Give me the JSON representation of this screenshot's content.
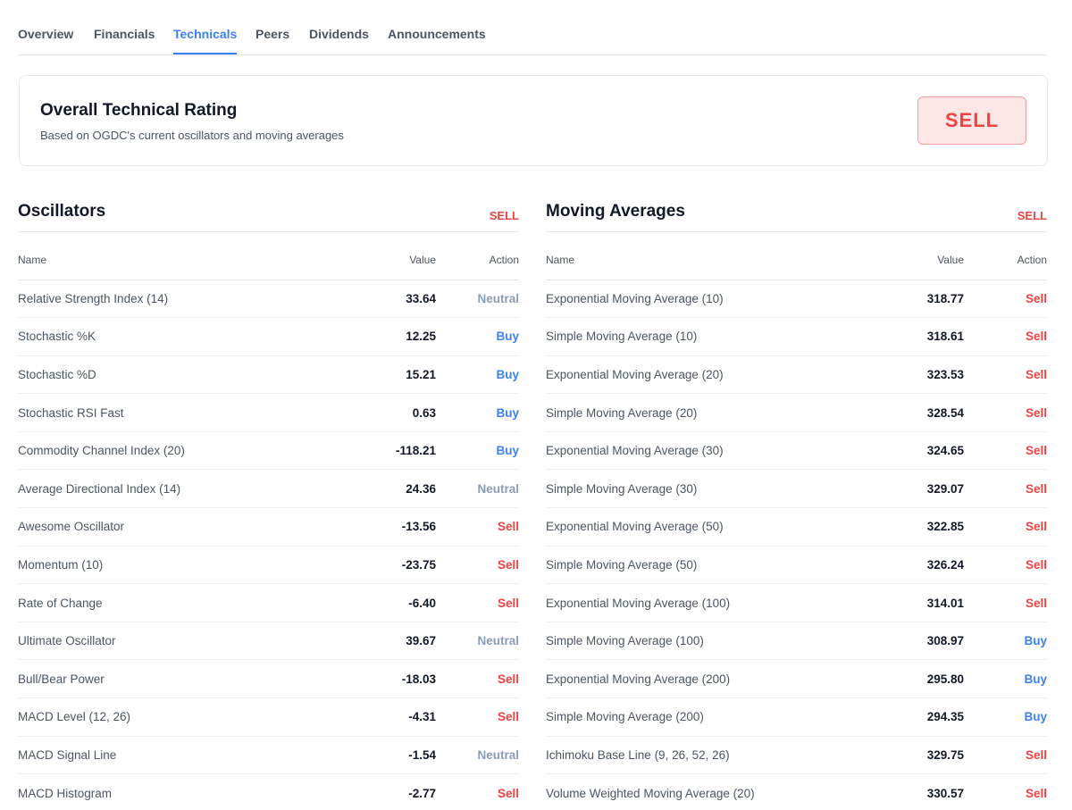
{
  "tabs": [
    "Overview",
    "Financials",
    "Technicals",
    "Peers",
    "Dividends",
    "Announcements"
  ],
  "active_tab": "Technicals",
  "rating": {
    "title": "Overall Technical Rating",
    "subtitle": "Based on OGDC's current oscillators and moving averages",
    "verdict": "SELL"
  },
  "oscillators": {
    "title": "Oscillators",
    "summary": "SELL",
    "headers": {
      "name": "Name",
      "value": "Value",
      "action": "Action"
    },
    "rows": [
      {
        "name": "Relative Strength Index (14)",
        "value": "33.64",
        "action": "Neutral"
      },
      {
        "name": "Stochastic %K",
        "value": "12.25",
        "action": "Buy"
      },
      {
        "name": "Stochastic %D",
        "value": "15.21",
        "action": "Buy"
      },
      {
        "name": "Stochastic RSI Fast",
        "value": "0.63",
        "action": "Buy"
      },
      {
        "name": "Commodity Channel Index (20)",
        "value": "-118.21",
        "action": "Buy"
      },
      {
        "name": "Average Directional Index (14)",
        "value": "24.36",
        "action": "Neutral"
      },
      {
        "name": "Awesome Oscillator",
        "value": "-13.56",
        "action": "Sell"
      },
      {
        "name": "Momentum (10)",
        "value": "-23.75",
        "action": "Sell"
      },
      {
        "name": "Rate of Change",
        "value": "-6.40",
        "action": "Sell"
      },
      {
        "name": "Ultimate Oscillator",
        "value": "39.67",
        "action": "Neutral"
      },
      {
        "name": "Bull/Bear Power",
        "value": "-18.03",
        "action": "Sell"
      },
      {
        "name": "MACD Level (12, 26)",
        "value": "-4.31",
        "action": "Sell"
      },
      {
        "name": "MACD Signal Line",
        "value": "-1.54",
        "action": "Neutral"
      },
      {
        "name": "MACD Histogram",
        "value": "-2.77",
        "action": "Sell"
      }
    ]
  },
  "moving_averages": {
    "title": "Moving Averages",
    "summary": "SELL",
    "headers": {
      "name": "Name",
      "value": "Value",
      "action": "Action"
    },
    "rows": [
      {
        "name": "Exponential Moving Average (10)",
        "value": "318.77",
        "action": "Sell"
      },
      {
        "name": "Simple Moving Average (10)",
        "value": "318.61",
        "action": "Sell"
      },
      {
        "name": "Exponential Moving Average (20)",
        "value": "323.53",
        "action": "Sell"
      },
      {
        "name": "Simple Moving Average (20)",
        "value": "328.54",
        "action": "Sell"
      },
      {
        "name": "Exponential Moving Average (30)",
        "value": "324.65",
        "action": "Sell"
      },
      {
        "name": "Simple Moving Average (30)",
        "value": "329.07",
        "action": "Sell"
      },
      {
        "name": "Exponential Moving Average (50)",
        "value": "322.85",
        "action": "Sell"
      },
      {
        "name": "Simple Moving Average (50)",
        "value": "326.24",
        "action": "Sell"
      },
      {
        "name": "Exponential Moving Average (100)",
        "value": "314.01",
        "action": "Sell"
      },
      {
        "name": "Simple Moving Average (100)",
        "value": "308.97",
        "action": "Buy"
      },
      {
        "name": "Exponential Moving Average (200)",
        "value": "295.80",
        "action": "Buy"
      },
      {
        "name": "Simple Moving Average (200)",
        "value": "294.35",
        "action": "Buy"
      },
      {
        "name": "Ichimoku Base Line (9, 26, 52, 26)",
        "value": "329.75",
        "action": "Sell"
      },
      {
        "name": "Volume Weighted Moving Average (20)",
        "value": "330.57",
        "action": "Sell"
      }
    ]
  },
  "colors": {
    "accent": "#3b82f6",
    "sell": "#ef4444",
    "buy": "#3b82f6",
    "neutral": "#8b9cb5"
  }
}
